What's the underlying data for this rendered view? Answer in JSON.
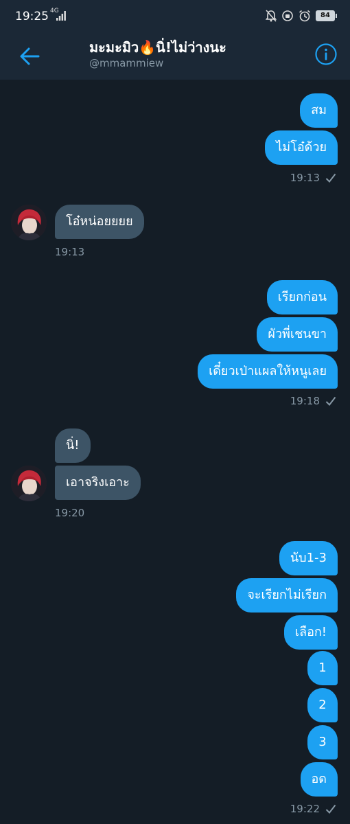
{
  "status_bar": {
    "time": "19:25",
    "network": "4G",
    "battery": "84"
  },
  "header": {
    "title": "มะมะมิว🔥นิ่!ไม่ว่างนะ",
    "handle": "@mmammiew"
  },
  "messages": {
    "m1": "สม",
    "m2": "ไม่โอ๋ด้วย",
    "t1": "19:13",
    "r1": "โอ๋หน่อยยยย",
    "t2": "19:13",
    "m3": "เรียกก่อน",
    "m4": "ผัวพี่เชนขา",
    "m5": "เดี๋ยวเป่าแผลให้หนูเลย",
    "t3": "19:18",
    "r2": "นิ่!",
    "r3": "เอาจริงเอาะ",
    "t4": "19:20",
    "m6": "นับ1-3",
    "m7": "จะเรียกไม่เรียก",
    "m8": "เลือก!",
    "m9": "1",
    "m10": "2",
    "m11": "3",
    "m12": "อด",
    "t5": "19:22"
  },
  "colors": {
    "accent": "#1da1f2",
    "background": "#141d26",
    "received_bubble": "#3d5466"
  }
}
